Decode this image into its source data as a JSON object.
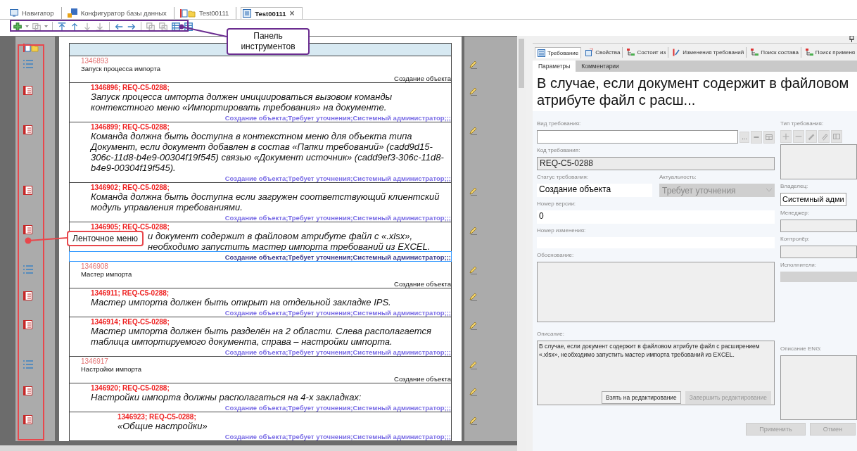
{
  "tabs": [
    {
      "label": "Навигатор",
      "selected": false
    },
    {
      "label": "Конфигуратор базы данных",
      "selected": false
    },
    {
      "label": "Test00111",
      "selected": false
    },
    {
      "label": "Test00111",
      "selected": true,
      "close": "×"
    }
  ],
  "toolbar": [
    {
      "disabled": false
    },
    {
      "disabled": true
    },
    {
      "disabled": false
    },
    {
      "disabled": false
    },
    {
      "disabled": true
    },
    {
      "disabled": true
    },
    {
      "disabled": false
    },
    {
      "disabled": false
    },
    {
      "disabled": true
    },
    {
      "disabled": true
    },
    {
      "disabled": false
    },
    {
      "disabled": false
    }
  ],
  "document": {
    "rows": [
      {
        "kind": "section",
        "id": "1346893",
        "title": "Запуск процесса импорта",
        "status": "Создание объекта",
        "selected": false,
        "children": [
          {
            "kind": "requirement",
            "id": "1346896; REQ-C5-0288;",
            "text": "Запуск процесса импорта должен инициироваться вызовом команды контекстного меню «Импортировать требования» на документе.",
            "tags": "Создание объекта;Требует уточнения;Системный администратор;;;",
            "selected": false
          },
          {
            "kind": "requirement",
            "id": "1346899; REQ-C5-0288;",
            "text": "Команда должна быть доступна в контекстном меню для объекта типа Документ, если документ добавлен в состав «Папки требований» (cadd9d15-306c-11d8-b4e9-00304f19f545) связью «Документ источник» (cadd9ef3-306c-11d8-b4e9-00304f19f545).",
            "tags": "Создание объекта;Требует уточнения;Системный администратор;;;",
            "selected": false
          },
          {
            "kind": "requirement",
            "id": "1346902; REQ-C5-0288;",
            "text": "Команда должна быть доступна если загружен соответствующий клиентский модуль управления требованиями.",
            "tags": "Создание объекта;Требует уточнения;Системный администратор;;;",
            "selected": false
          },
          {
            "kind": "requirement",
            "id": "1346905; REQ-C5-0288;",
            "text": "и документ содержит в файловом атрибуте файл с «.xlsx», необходимо запустить мастер импорта требований из EXCEL.",
            "tags": "Создание объекта;Требует уточнения;Системный администратор;;;",
            "selected": true
          }
        ]
      },
      {
        "kind": "section",
        "id": "1346908",
        "title": "Мастер импорта",
        "status": "Создание объекта",
        "selected": false,
        "children": [
          {
            "kind": "requirement",
            "id": "1346911; REQ-C5-0288;",
            "text": "Мастер импорта должен быть открыт на отдельной закладке IPS.",
            "tags": "Создание объекта;Требует уточнения;Системный администратор;;;",
            "selected": false
          },
          {
            "kind": "requirement",
            "id": "1346914; REQ-C5-0288;",
            "text": "Мастер импорта должен быть разделён на 2 области. Слева располагается таблица импортируемого документа, справа – настройки импорта.",
            "tags": "Создание объекта;Требует уточнения;Системный администратор;;;",
            "selected": false
          }
        ]
      },
      {
        "kind": "section",
        "id": "1346917",
        "title": "Настройки импорта",
        "status": "Создание объекта",
        "selected": false,
        "children": [
          {
            "kind": "requirement",
            "id": "1346920; REQ-C5-0288;",
            "text": "Настройки импорта должны располагаться на 4-х закладках:",
            "tags": "Создание объекта;Требует уточнения;Системный администратор;;;",
            "selected": false,
            "children": [
              {
                "kind": "requirement",
                "id": "1346923; REQ-C5-0288;",
                "text": "«Общие настройки»",
                "tags": "Создание объекта;Требует уточнения;Системный администратор;;;",
                "selected": false
              }
            ]
          }
        ]
      }
    ]
  },
  "details": {
    "tabs": [
      {
        "label": "Требование",
        "selected": true
      },
      {
        "label": "Свойства",
        "selected": false
      },
      {
        "label": "Состоит из",
        "selected": false
      },
      {
        "label": "Изменения требований",
        "selected": false
      },
      {
        "label": "Поиск состава",
        "selected": false
      },
      {
        "label": "Поиск применя",
        "selected": false
      }
    ],
    "subtabs": [
      {
        "label": "Параметры",
        "selected": true
      },
      {
        "label": "Комментарии",
        "selected": false
      }
    ],
    "title": "В случае, если документ содержит в файловом атрибуте файл с расш...",
    "kind_field": {
      "label": "Вид требования:",
      "button": "..."
    },
    "code_field": {
      "label": "Код требования:",
      "value": "REQ-C5-0288",
      "disabled": true
    },
    "status_field": {
      "label": "Статус требования:",
      "value": "Создание объекта"
    },
    "relevance_field": {
      "label": "Актуальность:",
      "value": "Требует уточнения",
      "disabled": true
    },
    "version_field": {
      "label": "Номер версии:",
      "value": "0"
    },
    "change_field": {
      "label": "Номер изменения:"
    },
    "justification_field": {
      "label": "Обоснование:"
    },
    "description_field": {
      "label": "Описание:",
      "value": "В случае, если документ содержит в файловом атрибуте файл с расширением «.xlsx», необходимо запустить мастер импорта требований из EXCEL."
    },
    "edit_buttons": [
      {
        "label": "Взять на редактирование",
        "disabled": false
      },
      {
        "label": "Завершить редактирование",
        "disabled": true
      }
    ],
    "type_field": {
      "label": "Тип требования:"
    },
    "owner_field": {
      "label": "Владелец:",
      "value": "Системный адми"
    },
    "manager_field": {
      "label": "Менеджер:"
    },
    "controller_field": {
      "label": "Контролёр:"
    },
    "executors_field": {
      "label": "Исполнители:"
    },
    "description_eng_field": {
      "label": "Описание ENG:"
    },
    "footer_buttons": [
      {
        "label": "Применить",
        "disabled": true
      },
      {
        "label": "Отмен",
        "disabled": true
      }
    ]
  },
  "annotations": [
    {
      "text": "Панель инструментов",
      "color": "#6b2d90"
    },
    {
      "text": "Ленточное меню",
      "color": "#e8474c"
    }
  ]
}
